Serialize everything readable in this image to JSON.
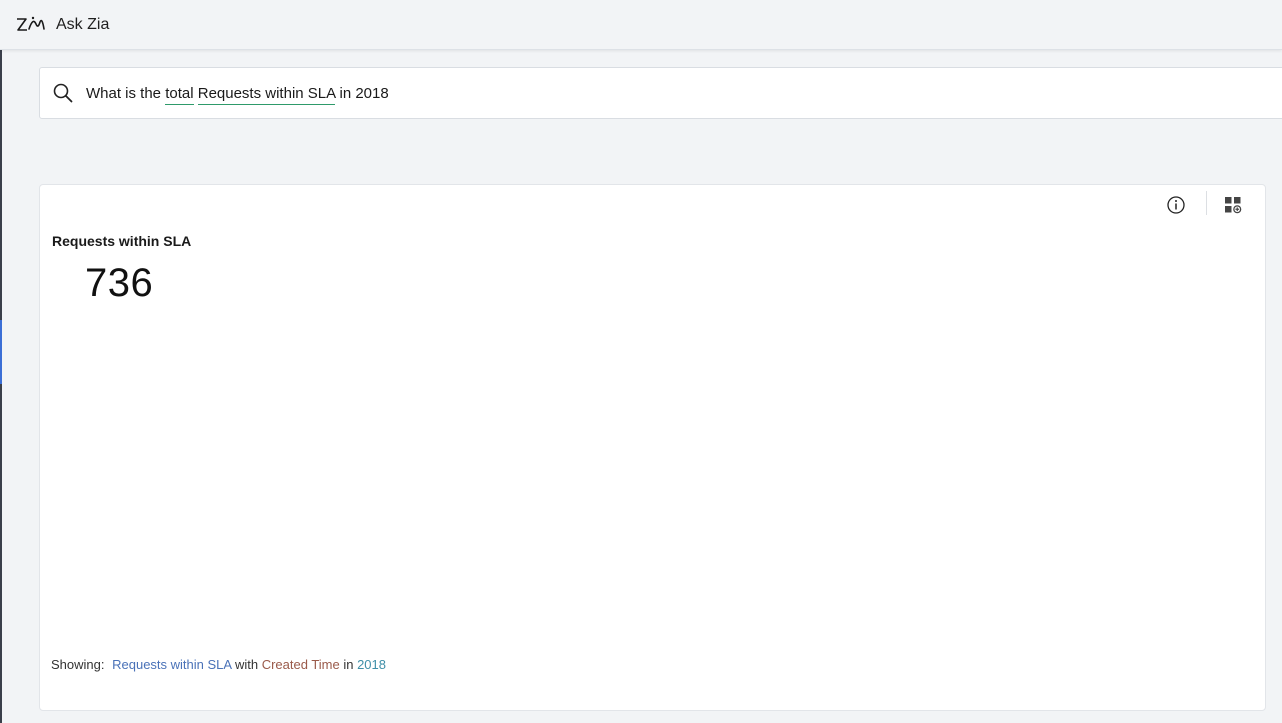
{
  "header": {
    "title": "Ask Zia",
    "logo_icon": "zia-logo-icon"
  },
  "search": {
    "icon": "search-icon",
    "query_parts": {
      "p1": "What is the ",
      "t1": "total",
      "p2": " ",
      "t2": "Requests within SLA",
      "p3": " in 2018"
    }
  },
  "result": {
    "metric_label": "Requests within SLA",
    "metric_value": "736",
    "toolbar_icons": [
      "info-icon",
      "add-to-dashboard-icon"
    ]
  },
  "footer": {
    "showing_label": "Showing:",
    "measure": "Requests within SLA",
    "w1": " with ",
    "dimension": "Created Time",
    "w2": " in ",
    "value": "2018"
  },
  "colors": {
    "token_underline": "#2e9a6a",
    "measure": "#4a72b8",
    "dimension": "#9a5a4a",
    "value": "#3f8fa8"
  }
}
